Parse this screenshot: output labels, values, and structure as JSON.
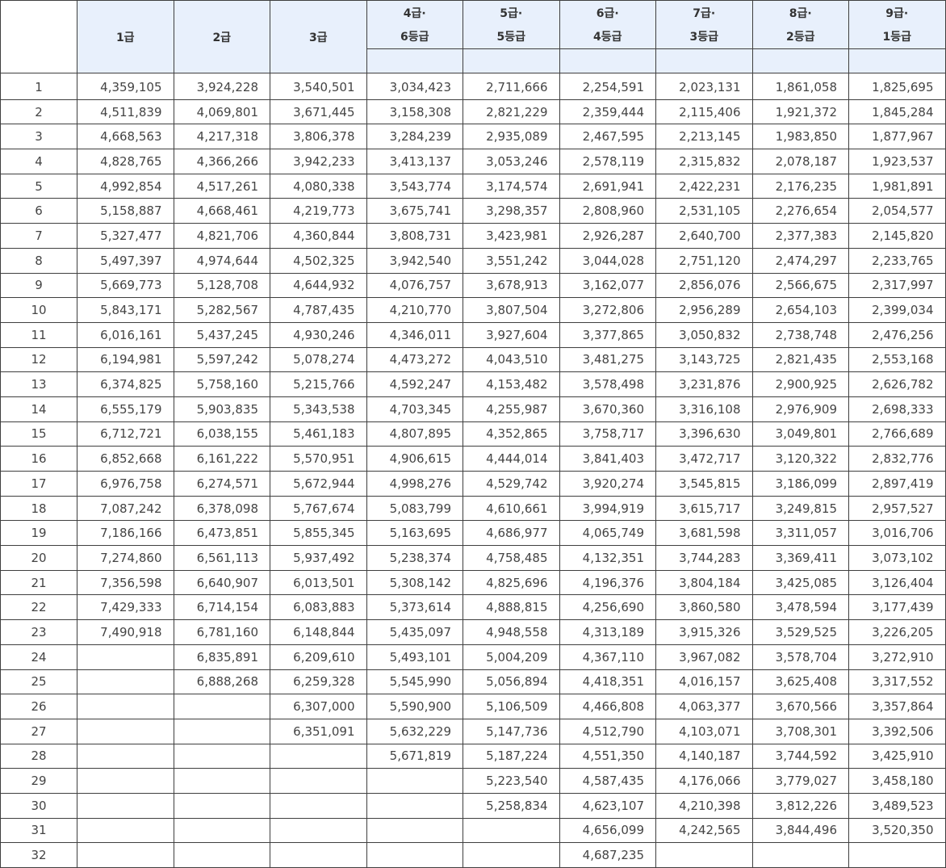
{
  "header": {
    "simple": [
      "1급",
      "2급",
      "3급"
    ],
    "dual": [
      {
        "top": "4급·",
        "bottom": "6등급"
      },
      {
        "top": "5급·",
        "bottom": "5등급"
      },
      {
        "top": "6급·",
        "bottom": "4등급"
      },
      {
        "top": "7급·",
        "bottom": "3등급"
      },
      {
        "top": "8급·",
        "bottom": "2등급"
      },
      {
        "top": "9급·",
        "bottom": "1등급"
      }
    ]
  },
  "rows": [
    [
      "1",
      "4,359,105",
      "3,924,228",
      "3,540,501",
      "3,034,423",
      "2,711,666",
      "2,254,591",
      "2,023,131",
      "1,861,058",
      "1,825,695"
    ],
    [
      "2",
      "4,511,839",
      "4,069,801",
      "3,671,445",
      "3,158,308",
      "2,821,229",
      "2,359,444",
      "2,115,406",
      "1,921,372",
      "1,845,284"
    ],
    [
      "3",
      "4,668,563",
      "4,217,318",
      "3,806,378",
      "3,284,239",
      "2,935,089",
      "2,467,595",
      "2,213,145",
      "1,983,850",
      "1,877,967"
    ],
    [
      "4",
      "4,828,765",
      "4,366,266",
      "3,942,233",
      "3,413,137",
      "3,053,246",
      "2,578,119",
      "2,315,832",
      "2,078,187",
      "1,923,537"
    ],
    [
      "5",
      "4,992,854",
      "4,517,261",
      "4,080,338",
      "3,543,774",
      "3,174,574",
      "2,691,941",
      "2,422,231",
      "2,176,235",
      "1,981,891"
    ],
    [
      "6",
      "5,158,887",
      "4,668,461",
      "4,219,773",
      "3,675,741",
      "3,298,357",
      "2,808,960",
      "2,531,105",
      "2,276,654",
      "2,054,577"
    ],
    [
      "7",
      "5,327,477",
      "4,821,706",
      "4,360,844",
      "3,808,731",
      "3,423,981",
      "2,926,287",
      "2,640,700",
      "2,377,383",
      "2,145,820"
    ],
    [
      "8",
      "5,497,397",
      "4,974,644",
      "4,502,325",
      "3,942,540",
      "3,551,242",
      "3,044,028",
      "2,751,120",
      "2,474,297",
      "2,233,765"
    ],
    [
      "9",
      "5,669,773",
      "5,128,708",
      "4,644,932",
      "4,076,757",
      "3,678,913",
      "3,162,077",
      "2,856,076",
      "2,566,675",
      "2,317,997"
    ],
    [
      "10",
      "5,843,171",
      "5,282,567",
      "4,787,435",
      "4,210,770",
      "3,807,504",
      "3,272,806",
      "2,956,289",
      "2,654,103",
      "2,399,034"
    ],
    [
      "11",
      "6,016,161",
      "5,437,245",
      "4,930,246",
      "4,346,011",
      "3,927,604",
      "3,377,865",
      "3,050,832",
      "2,738,748",
      "2,476,256"
    ],
    [
      "12",
      "6,194,981",
      "5,597,242",
      "5,078,274",
      "4,473,272",
      "4,043,510",
      "3,481,275",
      "3,143,725",
      "2,821,435",
      "2,553,168"
    ],
    [
      "13",
      "6,374,825",
      "5,758,160",
      "5,215,766",
      "4,592,247",
      "4,153,482",
      "3,578,498",
      "3,231,876",
      "2,900,925",
      "2,626,782"
    ],
    [
      "14",
      "6,555,179",
      "5,903,835",
      "5,343,538",
      "4,703,345",
      "4,255,987",
      "3,670,360",
      "3,316,108",
      "2,976,909",
      "2,698,333"
    ],
    [
      "15",
      "6,712,721",
      "6,038,155",
      "5,461,183",
      "4,807,895",
      "4,352,865",
      "3,758,717",
      "3,396,630",
      "3,049,801",
      "2,766,689"
    ],
    [
      "16",
      "6,852,668",
      "6,161,222",
      "5,570,951",
      "4,906,615",
      "4,444,014",
      "3,841,403",
      "3,472,717",
      "3,120,322",
      "2,832,776"
    ],
    [
      "17",
      "6,976,758",
      "6,274,571",
      "5,672,944",
      "4,998,276",
      "4,529,742",
      "3,920,274",
      "3,545,815",
      "3,186,099",
      "2,897,419"
    ],
    [
      "18",
      "7,087,242",
      "6,378,098",
      "5,767,674",
      "5,083,799",
      "4,610,661",
      "3,994,919",
      "3,615,717",
      "3,249,815",
      "2,957,527"
    ],
    [
      "19",
      "7,186,166",
      "6,473,851",
      "5,855,345",
      "5,163,695",
      "4,686,977",
      "4,065,749",
      "3,681,598",
      "3,311,057",
      "3,016,706"
    ],
    [
      "20",
      "7,274,860",
      "6,561,113",
      "5,937,492",
      "5,238,374",
      "4,758,485",
      "4,132,351",
      "3,744,283",
      "3,369,411",
      "3,073,102"
    ],
    [
      "21",
      "7,356,598",
      "6,640,907",
      "6,013,501",
      "5,308,142",
      "4,825,696",
      "4,196,376",
      "3,804,184",
      "3,425,085",
      "3,126,404"
    ],
    [
      "22",
      "7,429,333",
      "6,714,154",
      "6,083,883",
      "5,373,614",
      "4,888,815",
      "4,256,690",
      "3,860,580",
      "3,478,594",
      "3,177,439"
    ],
    [
      "23",
      "7,490,918",
      "6,781,160",
      "6,148,844",
      "5,435,097",
      "4,948,558",
      "4,313,189",
      "3,915,326",
      "3,529,525",
      "3,226,205"
    ],
    [
      "24",
      "",
      "6,835,891",
      "6,209,610",
      "5,493,101",
      "5,004,209",
      "4,367,110",
      "3,967,082",
      "3,578,704",
      "3,272,910"
    ],
    [
      "25",
      "",
      "6,888,268",
      "6,259,328",
      "5,545,990",
      "5,056,894",
      "4,418,351",
      "4,016,157",
      "3,625,408",
      "3,317,552"
    ],
    [
      "26",
      "",
      "",
      "6,307,000",
      "5,590,900",
      "5,106,509",
      "4,466,808",
      "4,063,377",
      "3,670,566",
      "3,357,864"
    ],
    [
      "27",
      "",
      "",
      "6,351,091",
      "5,632,229",
      "5,147,736",
      "4,512,790",
      "4,103,071",
      "3,708,301",
      "3,392,506"
    ],
    [
      "28",
      "",
      "",
      "",
      "5,671,819",
      "5,187,224",
      "4,551,350",
      "4,140,187",
      "3,744,592",
      "3,425,910"
    ],
    [
      "29",
      "",
      "",
      "",
      "",
      "5,223,540",
      "4,587,435",
      "4,176,066",
      "3,779,027",
      "3,458,180"
    ],
    [
      "30",
      "",
      "",
      "",
      "",
      "5,258,834",
      "4,623,107",
      "4,210,398",
      "3,812,226",
      "3,489,523"
    ],
    [
      "31",
      "",
      "",
      "",
      "",
      "",
      "4,656,099",
      "4,242,565",
      "3,844,496",
      "3,520,350"
    ],
    [
      "32",
      "",
      "",
      "",
      "",
      "",
      "4,687,235",
      "",
      "",
      ""
    ]
  ]
}
